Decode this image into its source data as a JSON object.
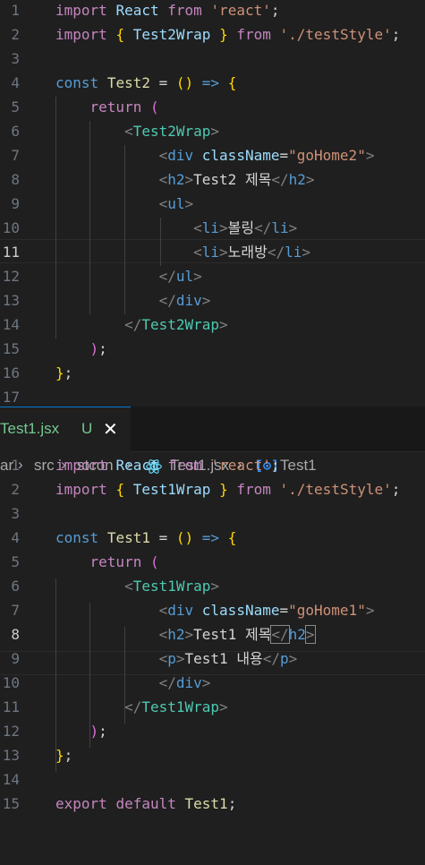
{
  "top_pane": {
    "lines": [
      {
        "n": "1",
        "tokens": [
          [
            "kw-pink",
            "import"
          ],
          [
            "text",
            " "
          ],
          [
            "ident",
            "React"
          ],
          [
            "text",
            " "
          ],
          [
            "kw-pink",
            "from"
          ],
          [
            "text",
            " "
          ],
          [
            "str",
            "'react'"
          ],
          [
            "text",
            ";"
          ]
        ]
      },
      {
        "n": "2",
        "tokens": [
          [
            "kw-pink",
            "import"
          ],
          [
            "text",
            " "
          ],
          [
            "br1",
            "{"
          ],
          [
            "text",
            " "
          ],
          [
            "ident",
            "Test2Wrap"
          ],
          [
            "text",
            " "
          ],
          [
            "br1",
            "}"
          ],
          [
            "text",
            " "
          ],
          [
            "kw-pink",
            "from"
          ],
          [
            "text",
            " "
          ],
          [
            "str",
            "'./testStyle'"
          ],
          [
            "text",
            ";"
          ]
        ]
      },
      {
        "n": "3",
        "tokens": []
      },
      {
        "n": "4",
        "tokens": [
          [
            "kw-blue",
            "const"
          ],
          [
            "text",
            " "
          ],
          [
            "fn",
            "Test2"
          ],
          [
            "text",
            " = "
          ],
          [
            "br1",
            "()"
          ],
          [
            "text",
            " "
          ],
          [
            "kw-blue",
            "=>"
          ],
          [
            "text",
            " "
          ],
          [
            "br1",
            "{"
          ]
        ]
      },
      {
        "n": "5",
        "tokens": [
          [
            "text",
            "    "
          ],
          [
            "kw-pink",
            "return"
          ],
          [
            "text",
            " "
          ],
          [
            "br2",
            "("
          ]
        ]
      },
      {
        "n": "6",
        "tokens": [
          [
            "text",
            "        "
          ],
          [
            "punc",
            "<"
          ],
          [
            "comp",
            "Test2Wrap"
          ],
          [
            "punc",
            ">"
          ]
        ]
      },
      {
        "n": "7",
        "tokens": [
          [
            "text",
            "            "
          ],
          [
            "punc",
            "<"
          ],
          [
            "tag",
            "div"
          ],
          [
            "text",
            " "
          ],
          [
            "ident",
            "className"
          ],
          [
            "text",
            "="
          ],
          [
            "str",
            "\"goHome2\""
          ],
          [
            "punc",
            ">"
          ]
        ]
      },
      {
        "n": "8",
        "tokens": [
          [
            "text",
            "            "
          ],
          [
            "punc",
            "<"
          ],
          [
            "tag",
            "h2"
          ],
          [
            "punc",
            ">"
          ],
          [
            "text",
            "Test2 제목"
          ],
          [
            "punc",
            "</"
          ],
          [
            "tag",
            "h2"
          ],
          [
            "punc",
            ">"
          ]
        ]
      },
      {
        "n": "9",
        "tokens": [
          [
            "text",
            "            "
          ],
          [
            "punc",
            "<"
          ],
          [
            "tag",
            "ul"
          ],
          [
            "punc",
            ">"
          ]
        ]
      },
      {
        "n": "10",
        "tokens": [
          [
            "text",
            "                "
          ],
          [
            "punc",
            "<"
          ],
          [
            "tag",
            "li"
          ],
          [
            "punc",
            ">"
          ],
          [
            "text",
            "볼링"
          ],
          [
            "punc",
            "</"
          ],
          [
            "tag",
            "li"
          ],
          [
            "punc",
            ">"
          ]
        ]
      },
      {
        "n": "11",
        "tokens": [
          [
            "text",
            "                "
          ],
          [
            "punc",
            "<"
          ],
          [
            "tag",
            "li"
          ],
          [
            "punc",
            ">"
          ],
          [
            "text",
            "노래방"
          ],
          [
            "punc",
            "</"
          ],
          [
            "tag",
            "li"
          ],
          [
            "punc",
            ">"
          ]
        ]
      },
      {
        "n": "12",
        "tokens": [
          [
            "text",
            "            "
          ],
          [
            "punc",
            "</"
          ],
          [
            "tag",
            "ul"
          ],
          [
            "punc",
            ">"
          ]
        ]
      },
      {
        "n": "13",
        "tokens": [
          [
            "text",
            "            "
          ],
          [
            "punc",
            "</"
          ],
          [
            "tag",
            "div"
          ],
          [
            "punc",
            ">"
          ]
        ]
      },
      {
        "n": "14",
        "tokens": [
          [
            "text",
            "        "
          ],
          [
            "punc",
            "</"
          ],
          [
            "comp",
            "Test2Wrap"
          ],
          [
            "punc",
            ">"
          ]
        ]
      },
      {
        "n": "15",
        "tokens": [
          [
            "text",
            "    "
          ],
          [
            "br2",
            ")"
          ],
          [
            "text",
            ";"
          ]
        ]
      },
      {
        "n": "16",
        "tokens": [
          [
            "br1",
            "}"
          ],
          [
            "text",
            ";"
          ]
        ]
      },
      {
        "n": "17",
        "tokens": []
      }
    ]
  },
  "tab": {
    "name": "Test1.jsx",
    "status": "U",
    "close_glyph": "✕"
  },
  "breadcrumb": {
    "items": [
      "ar",
      "src",
      "stcon",
      "Test1.jsx",
      "Test1"
    ],
    "separator": "›",
    "symbol_glyph": "[⊙]"
  },
  "bottom_pane": {
    "lines": [
      {
        "n": "1",
        "tokens": [
          [
            "kw-pink",
            "import"
          ],
          [
            "text",
            " "
          ],
          [
            "ident",
            "React"
          ],
          [
            "text",
            " "
          ],
          [
            "kw-pink",
            "from"
          ],
          [
            "text",
            " "
          ],
          [
            "str",
            "'react'"
          ],
          [
            "text",
            ";"
          ]
        ]
      },
      {
        "n": "2",
        "tokens": [
          [
            "kw-pink",
            "import"
          ],
          [
            "text",
            " "
          ],
          [
            "br1",
            "{"
          ],
          [
            "text",
            " "
          ],
          [
            "ident",
            "Test1Wrap"
          ],
          [
            "text",
            " "
          ],
          [
            "br1",
            "}"
          ],
          [
            "text",
            " "
          ],
          [
            "kw-pink",
            "from"
          ],
          [
            "text",
            " "
          ],
          [
            "str",
            "'./testStyle'"
          ],
          [
            "text",
            ";"
          ]
        ]
      },
      {
        "n": "3",
        "tokens": []
      },
      {
        "n": "4",
        "tokens": [
          [
            "kw-blue",
            "const"
          ],
          [
            "text",
            " "
          ],
          [
            "fn",
            "Test1"
          ],
          [
            "text",
            " = "
          ],
          [
            "br1",
            "()"
          ],
          [
            "text",
            " "
          ],
          [
            "kw-blue",
            "=>"
          ],
          [
            "text",
            " "
          ],
          [
            "br1",
            "{"
          ]
        ]
      },
      {
        "n": "5",
        "tokens": [
          [
            "text",
            "    "
          ],
          [
            "kw-pink",
            "return"
          ],
          [
            "text",
            " "
          ],
          [
            "br2",
            "("
          ]
        ]
      },
      {
        "n": "6",
        "tokens": [
          [
            "text",
            "        "
          ],
          [
            "punc",
            "<"
          ],
          [
            "comp",
            "Test1Wrap"
          ],
          [
            "punc",
            ">"
          ]
        ]
      },
      {
        "n": "7",
        "tokens": [
          [
            "text",
            "            "
          ],
          [
            "punc",
            "<"
          ],
          [
            "tag",
            "div"
          ],
          [
            "text",
            " "
          ],
          [
            "ident",
            "className"
          ],
          [
            "text",
            "="
          ],
          [
            "str",
            "\"goHome1\""
          ],
          [
            "punc",
            ">"
          ]
        ]
      },
      {
        "n": "8",
        "tokens": [
          [
            "text",
            "            "
          ],
          [
            "punc",
            "<"
          ],
          [
            "tag",
            "h2"
          ],
          [
            "punc",
            ">"
          ],
          [
            "text",
            "Test1 제목"
          ],
          [
            "punc match",
            "</"
          ],
          [
            "tag",
            "h2"
          ],
          [
            "punc match",
            ">"
          ]
        ]
      },
      {
        "n": "9",
        "tokens": [
          [
            "text",
            "            "
          ],
          [
            "punc",
            "<"
          ],
          [
            "tag",
            "p"
          ],
          [
            "punc",
            ">"
          ],
          [
            "text",
            "Test1 내용"
          ],
          [
            "punc",
            "</"
          ],
          [
            "tag",
            "p"
          ],
          [
            "punc",
            ">"
          ]
        ]
      },
      {
        "n": "10",
        "tokens": [
          [
            "text",
            "            "
          ],
          [
            "punc",
            "</"
          ],
          [
            "tag",
            "div"
          ],
          [
            "punc",
            ">"
          ]
        ]
      },
      {
        "n": "11",
        "tokens": [
          [
            "text",
            "        "
          ],
          [
            "punc",
            "</"
          ],
          [
            "comp",
            "Test1Wrap"
          ],
          [
            "punc",
            ">"
          ]
        ]
      },
      {
        "n": "12",
        "tokens": [
          [
            "text",
            "    "
          ],
          [
            "br2",
            ")"
          ],
          [
            "text",
            ";"
          ]
        ]
      },
      {
        "n": "13",
        "tokens": [
          [
            "br1",
            "}"
          ],
          [
            "text",
            ";"
          ]
        ]
      },
      {
        "n": "14",
        "tokens": []
      },
      {
        "n": "15",
        "tokens": [
          [
            "kw-pink",
            "export"
          ],
          [
            "text",
            " "
          ],
          [
            "kw-pink",
            "default"
          ],
          [
            "text",
            " "
          ],
          [
            "fn",
            "Test1"
          ],
          [
            "text",
            ";"
          ]
        ]
      }
    ]
  },
  "colors": {
    "editor_bg": "#1f1f1f",
    "tab_untracked": "#73c991",
    "line_number": "#6e7681"
  }
}
